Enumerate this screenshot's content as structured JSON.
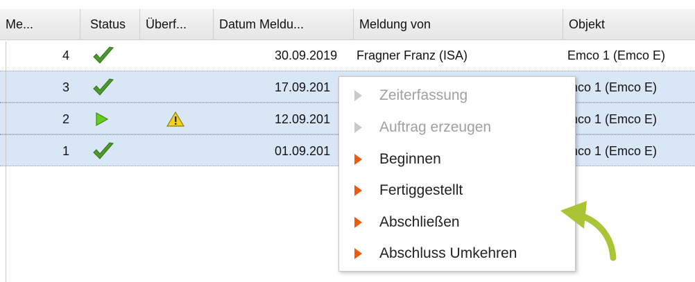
{
  "columns": [
    {
      "label": "Me..."
    },
    {
      "label": "Status"
    },
    {
      "label": "Überf..."
    },
    {
      "label": "Datum Meldu..."
    },
    {
      "label": "Meldung von"
    },
    {
      "label": "Objekt"
    }
  ],
  "rows": [
    {
      "nr": "4",
      "status_icon": "checkmark-icon",
      "warning": false,
      "datum": "30.09.2019",
      "meldung_von": "Fragner Franz (ISA)",
      "objekt": "Emco 1 (Emco E)"
    },
    {
      "nr": "3",
      "status_icon": "checkmark-icon",
      "warning": false,
      "datum": "17.09.201",
      "meldung_von": "",
      "objekt": "mco 1 (Emco E)"
    },
    {
      "nr": "2",
      "status_icon": "play-icon",
      "warning": true,
      "datum": "12.09.201",
      "meldung_von": "",
      "objekt": "mco 1 (Emco E)"
    },
    {
      "nr": "1",
      "status_icon": "checkmark-icon",
      "warning": false,
      "datum": "01.09.201",
      "meldung_von": "",
      "objekt": "mco 1 (Emco E)"
    }
  ],
  "context_menu": {
    "items": [
      {
        "label": "Zeiterfassung",
        "enabled": false
      },
      {
        "label": "Auftrag erzeugen",
        "enabled": false
      },
      {
        "label": "Beginnen",
        "enabled": true
      },
      {
        "label": "Fertiggestellt",
        "enabled": true
      },
      {
        "label": "Abschließen",
        "enabled": true
      },
      {
        "label": "Abschluss Umkehren",
        "enabled": true
      }
    ]
  },
  "colors": {
    "selection": "#d9e6f6",
    "menu_arrow_active": "#ee5a0e",
    "menu_arrow_disabled": "#c9c9c9",
    "annotation_arrow": "#a9c536",
    "checkmark": "#4c9a2a",
    "play": "#66cc22",
    "warning": "#f2d21b"
  }
}
